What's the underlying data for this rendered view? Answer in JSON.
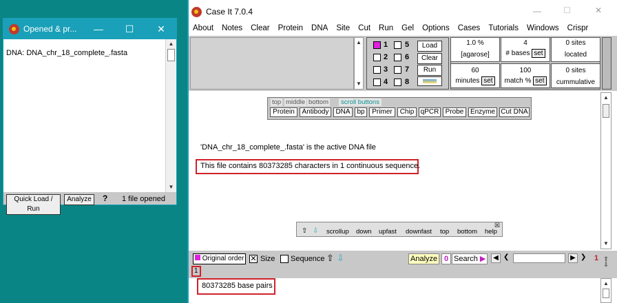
{
  "left_window": {
    "title": "Opened & pr...",
    "content": "DNA: DNA_chr_18_complete_.fasta",
    "footer": {
      "quick_load": "Quick Load / Run",
      "analyze": "Analyze",
      "help": "?",
      "status": "1 file opened"
    }
  },
  "main_window": {
    "title": "Case It 7.0.4",
    "menu": [
      "About",
      "Notes",
      "Clear",
      "Protein",
      "DNA",
      "Site",
      "Cut",
      "Run",
      "Gel",
      "Options",
      "Cases",
      "Tutorials",
      "Windows",
      "Crispr"
    ],
    "lanes": [
      "1",
      "5",
      "2",
      "6",
      "3",
      "7",
      "4",
      "8"
    ],
    "buttons": {
      "load": "Load",
      "clear": "Clear",
      "run": "Run"
    },
    "params": {
      "agarose_value": "1.0 %",
      "agarose_label": "[agarose]",
      "bases_value": "4",
      "bases_label": "# bases",
      "set": "set",
      "sites_value1": "0 sites",
      "sites_label1": "located",
      "minutes_value": "60",
      "minutes_label": "minutes",
      "match_value": "100",
      "match_label": "match %",
      "sites_value2": "0 sites",
      "sites_label2": "cummulative"
    },
    "toolbar_tabs": [
      "top",
      "middle",
      "bottom",
      "scroll buttons"
    ],
    "toolbar_buttons": [
      "Protein",
      "Antibody",
      "DNA",
      "bp",
      "Primer",
      "Chip",
      "qPCR",
      "Probe",
      "Enzyme",
      "Cut DNA"
    ],
    "active_file_msg": "'DNA_chr_18_complete_.fasta' is the active DNA file",
    "contains_msg": "This file contains 80373285 characters in 1 continuous sequence.",
    "nav": [
      "scrollup",
      "down",
      "upfast",
      "downfast",
      "top",
      "bottom",
      "help"
    ],
    "lower": {
      "original_order": "Original order",
      "size": "Size",
      "sequence": "Sequence",
      "analyze": "Analyze",
      "search_num": "0",
      "search": "Search",
      "page_num": "1",
      "lane_num": "1"
    },
    "base_pairs": "80373285 base pairs"
  }
}
